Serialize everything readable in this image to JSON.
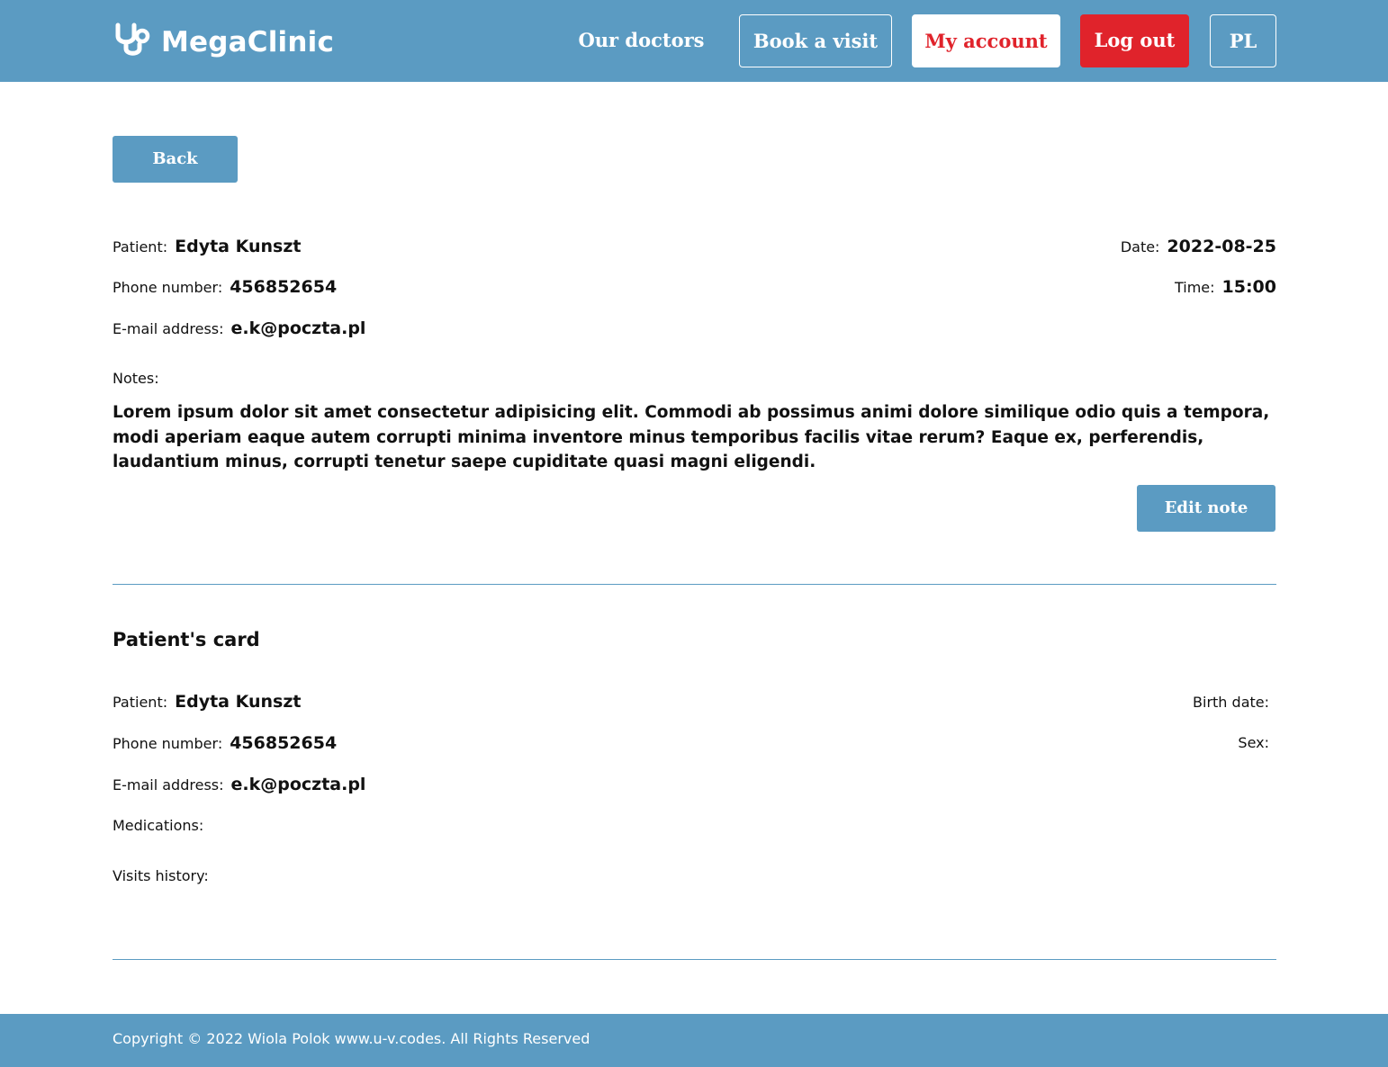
{
  "header": {
    "logo_text": "MegaClinic",
    "nav": {
      "doctors": "Our doctors",
      "book": "Book a visit",
      "account": "My account",
      "logout": "Log out",
      "lang": "PL"
    }
  },
  "back_button": "Back",
  "visit": {
    "patient_label": "Patient:",
    "patient": "Edyta Kunszt",
    "phone_label": "Phone number:",
    "phone": "456852654",
    "email_label": "E-mail address:",
    "email": "e.k@poczta.pl",
    "date_label": "Date:",
    "date": "2022-08-25",
    "time_label": "Time:",
    "time": "15:00",
    "notes_label": "Notes:",
    "notes": "Lorem ipsum dolor sit amet consectetur adipisicing elit. Commodi ab possimus animi dolore similique odio quis a tempora, modi aperiam eaque autem corrupti minima inventore minus temporibus facilis vitae rerum? Eaque ex, perferendis, laudantium minus, corrupti tenetur saepe cupiditate quasi magni eligendi.",
    "edit_button": "Edit note"
  },
  "card": {
    "title": "Patient's card",
    "patient_label": "Patient:",
    "patient": "Edyta Kunszt",
    "phone_label": "Phone number:",
    "phone": "456852654",
    "email_label": "E-mail address:",
    "email": "e.k@poczta.pl",
    "birth_label": "Birth date:",
    "sex_label": "Sex:",
    "medications_label": "Medications:",
    "history_label": "Visits history:"
  },
  "footer": {
    "copyright": "Copyright © 2022 Wiola Polok www.u-v.codes. All Rights Reserved"
  },
  "colors": {
    "brand": "#5b9bc2",
    "danger": "#e0232b",
    "white": "#ffffff"
  },
  "icons": {
    "logo": "stethoscope-icon"
  }
}
